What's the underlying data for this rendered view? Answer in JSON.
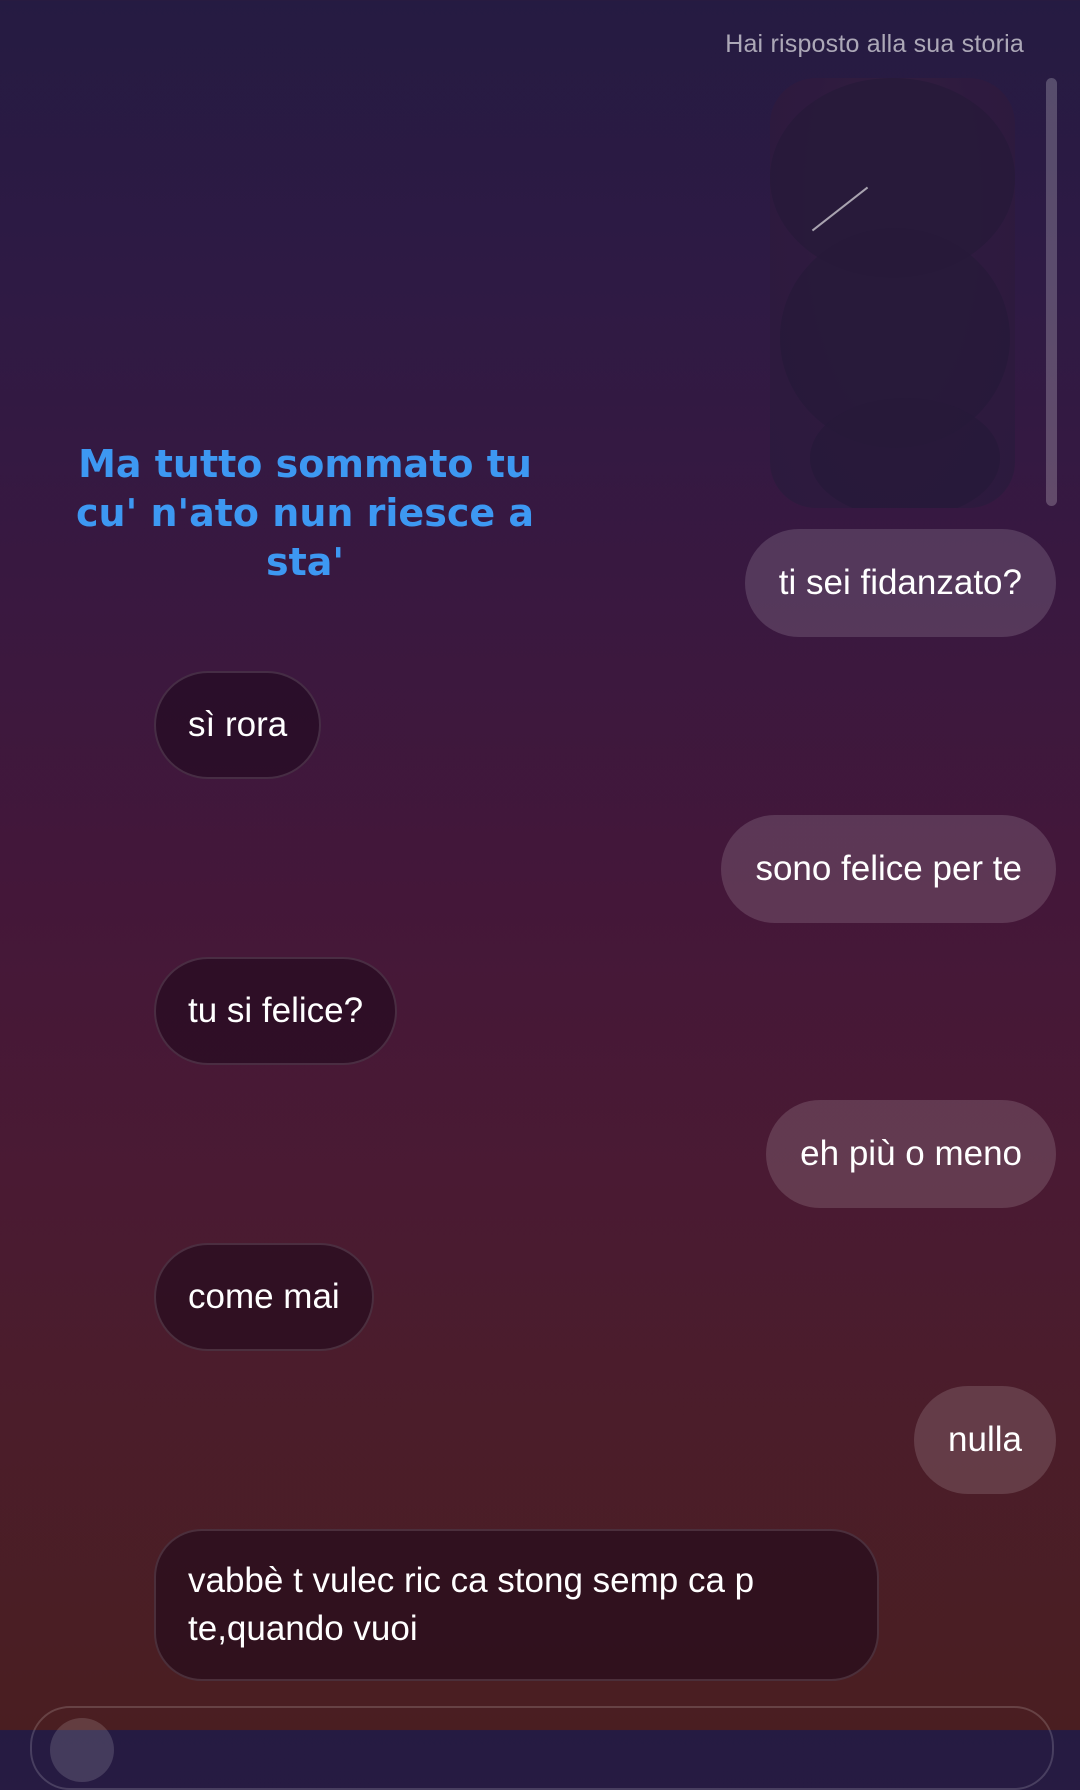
{
  "story_reply": {
    "caption": "Hai risposto alla sua storia",
    "story_text": "Ma tutto sommato tu cu' n'ato nun riesce a sta'"
  },
  "messages": [
    {
      "direction": "sent",
      "text": "ti sei fidanzato?"
    },
    {
      "direction": "received",
      "text": "sì rora"
    },
    {
      "direction": "sent",
      "text": "sono felice per te"
    },
    {
      "direction": "received",
      "text": "tu si felice?"
    },
    {
      "direction": "sent",
      "text": "eh più o meno"
    },
    {
      "direction": "received",
      "text": "come mai"
    },
    {
      "direction": "sent",
      "text": "nulla"
    },
    {
      "direction": "received",
      "text": "vabbè t vulec ric ca stong semp ca p te,quando vuoi"
    }
  ],
  "colors": {
    "story_text": "#3d98f2",
    "sent_bubble": "rgba(255,255,255,0.14)",
    "received_bubble": "rgba(28,8,26,0.55)"
  }
}
